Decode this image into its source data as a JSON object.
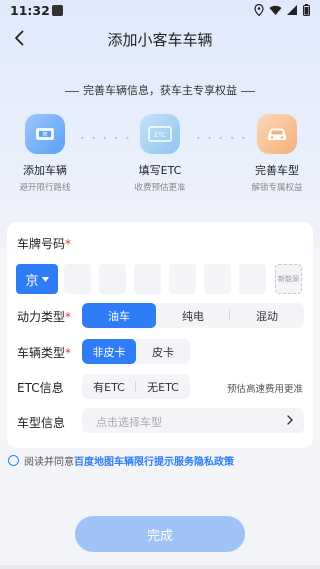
{
  "status_bar": {
    "time": "11:32"
  },
  "header": {
    "title": "添加小客车车辆"
  },
  "benefit_tagline": "完善车辆信息，获车主专享权益",
  "steps": [
    {
      "title": "添加车辆",
      "subtitle": "避开限行路线",
      "icon": "plate-icon",
      "color": "#5aa0f5"
    },
    {
      "title": "填写ETC",
      "subtitle": "收费预估更准",
      "icon": "etc-icon",
      "color": "#8ec4ef"
    },
    {
      "title": "完善车型",
      "subtitle": "解锁专属权益",
      "icon": "car-icon",
      "color": "#f3b27a"
    }
  ],
  "form": {
    "plate": {
      "label": "车牌号码",
      "required": "*",
      "province": "京",
      "new_energy_label": "新能源"
    },
    "power_type": {
      "label": "动力类型",
      "required": "*",
      "options": [
        "油车",
        "纯电",
        "混动"
      ],
      "selected": "油车"
    },
    "vehicle_type": {
      "label": "车辆类型",
      "required": "*",
      "options": [
        "非皮卡",
        "皮卡"
      ],
      "selected": "非皮卡"
    },
    "etc": {
      "label": "ETC信息",
      "options": [
        "有ETC",
        "无ETC"
      ],
      "hint": "预估高速费用更准"
    },
    "model": {
      "label": "车型信息",
      "placeholder": "点击选择车型"
    }
  },
  "agreement": {
    "prefix": "阅读并同意",
    "link": "百度地图车辆限行提示服务隐私政策"
  },
  "submit_label": "完成",
  "colors": {
    "accent": "#2f7df6",
    "required": "#e23c3c",
    "button_disabled": "#9fc2f7"
  }
}
